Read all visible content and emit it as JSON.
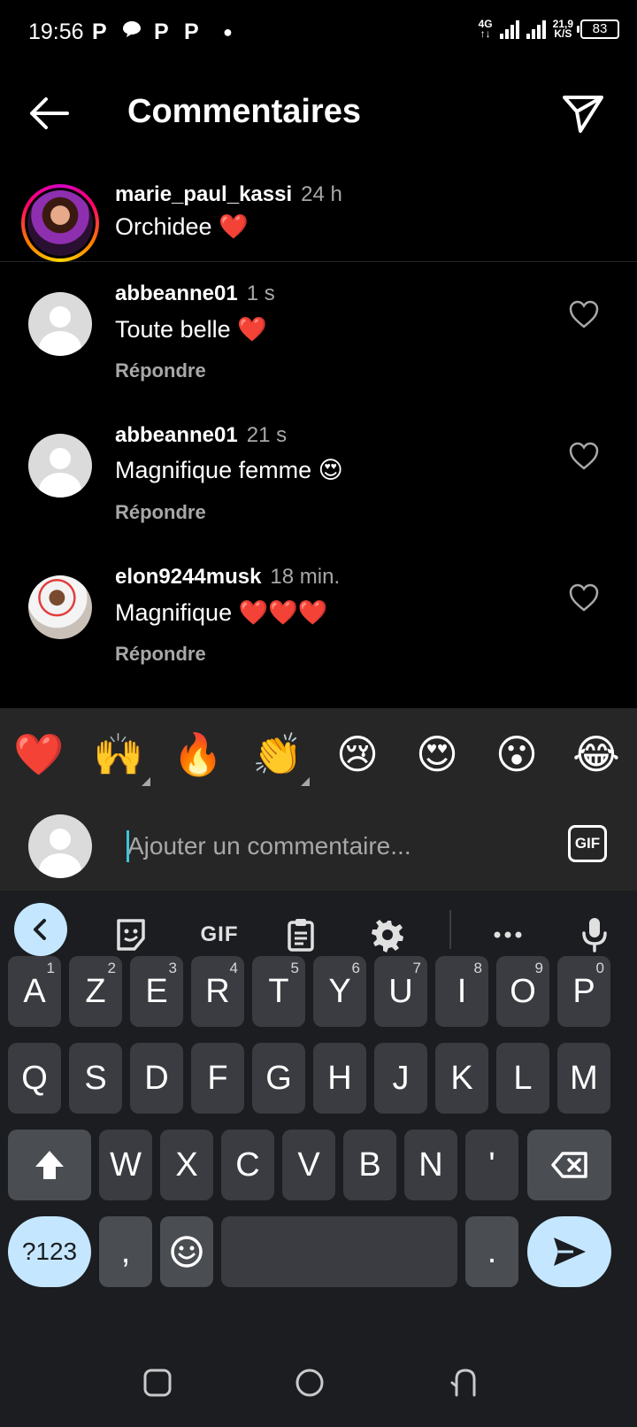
{
  "status": {
    "time": "19:56",
    "notifications": [
      "P",
      "P",
      "P"
    ],
    "net_type_top": "4G",
    "net_type_bottom": "↑↓",
    "speed_value": "21,9",
    "speed_unit": "K/S",
    "battery": "83"
  },
  "header": {
    "title": "Commentaires"
  },
  "caption": {
    "username": "marie_paul_kassi",
    "time": "24 h",
    "text": "Orchidee ❤️"
  },
  "comments": [
    {
      "username": "abbeanne01",
      "time": "1 s",
      "text": "Toute belle ❤️",
      "reply": "Répondre"
    },
    {
      "username": "abbeanne01",
      "time": "21 s",
      "text": "Magnifique femme 😍",
      "reply": "Répondre"
    },
    {
      "username": "elon9244musk",
      "time": "18 min.",
      "text": "Magnifique ❤️❤️❤️",
      "reply": "Répondre"
    }
  ],
  "emoji_bar": [
    "❤️",
    "🙌",
    "🔥",
    "👏",
    "😢",
    "😍",
    "😮",
    "😂"
  ],
  "composer": {
    "placeholder": "Ajouter un commentaire...",
    "gif_label": "GIF"
  },
  "keyboard": {
    "toolbar_gif": "GIF",
    "row1": [
      {
        "k": "A",
        "h": "1"
      },
      {
        "k": "Z",
        "h": "2"
      },
      {
        "k": "E",
        "h": "3"
      },
      {
        "k": "R",
        "h": "4"
      },
      {
        "k": "T",
        "h": "5"
      },
      {
        "k": "Y",
        "h": "6"
      },
      {
        "k": "U",
        "h": "7"
      },
      {
        "k": "I",
        "h": "8"
      },
      {
        "k": "O",
        "h": "9"
      },
      {
        "k": "P",
        "h": "0"
      }
    ],
    "row2": [
      "Q",
      "S",
      "D",
      "F",
      "G",
      "H",
      "J",
      "K",
      "L",
      "M"
    ],
    "row3": [
      "W",
      "X",
      "C",
      "V",
      "B",
      "N",
      "'"
    ],
    "symbols_key": "?123",
    "comma_key": ",",
    "period_key": "."
  }
}
